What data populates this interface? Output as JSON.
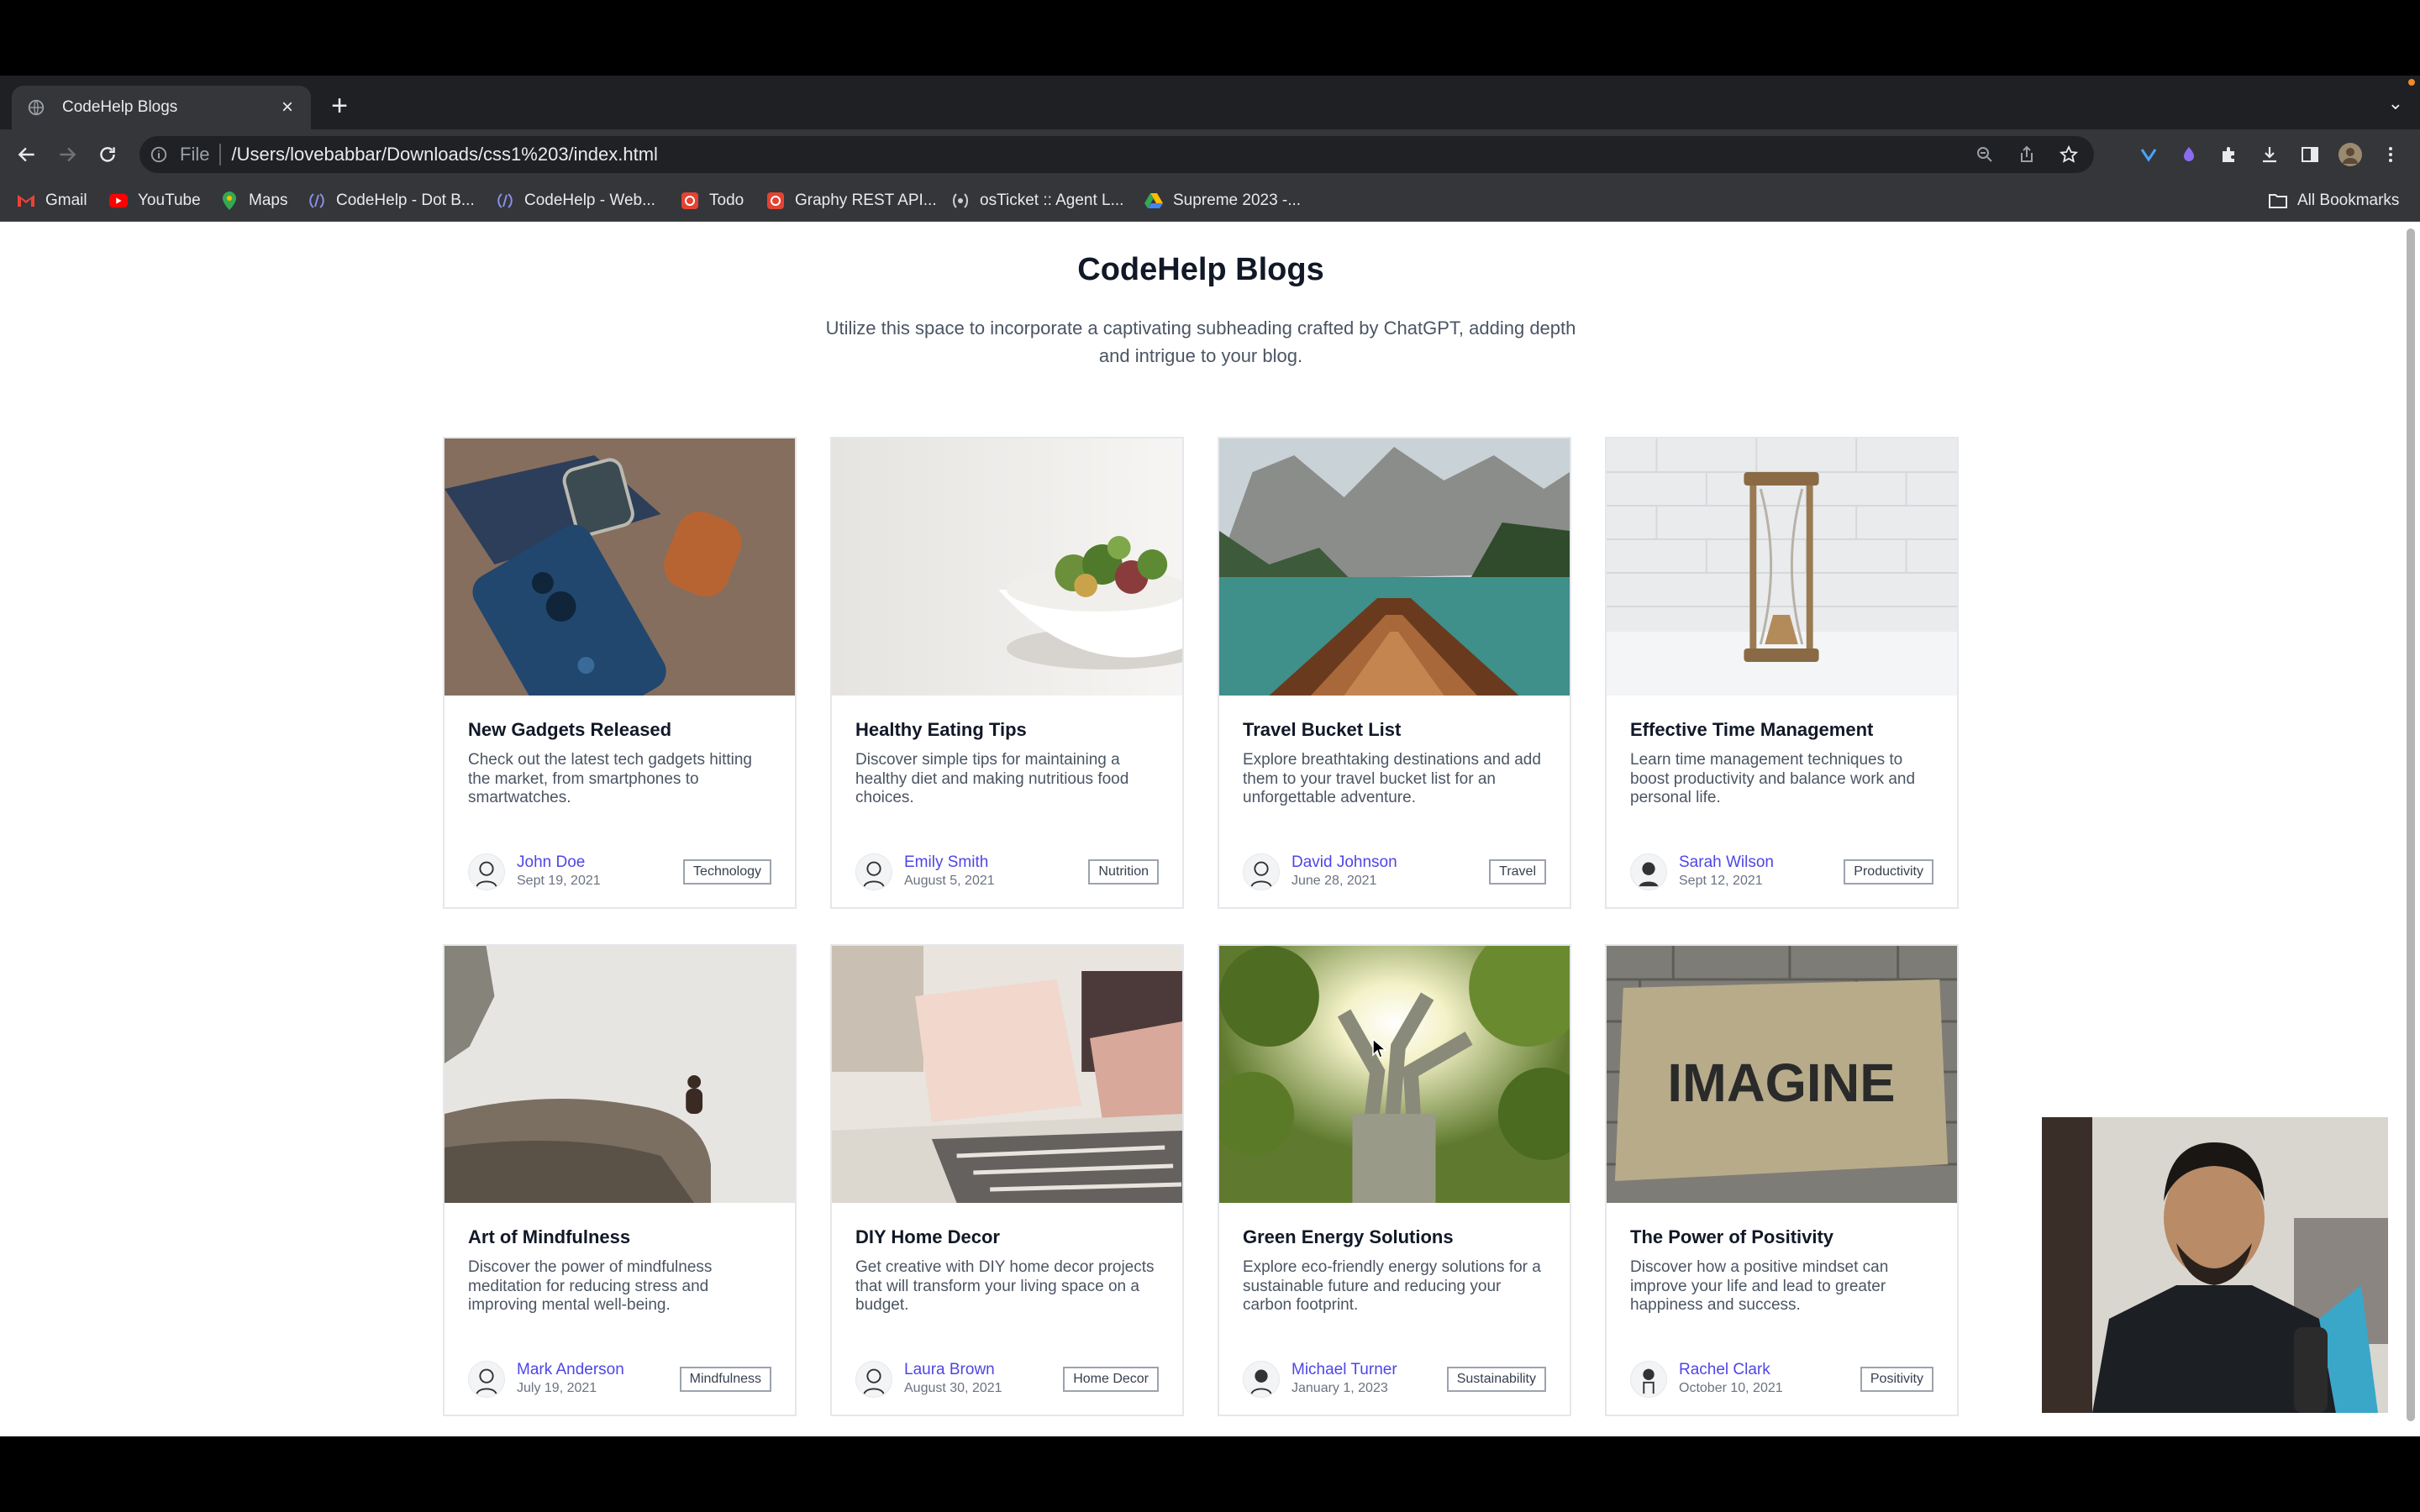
{
  "browser": {
    "tab_title": "CodeHelp Blogs",
    "new_tab_label": "+",
    "scheme_label": "File",
    "url": "/Users/lovebabbar/Downloads/css1%203/index.html"
  },
  "bookmarks": [
    {
      "label": "Gmail",
      "icon": "gmail-icon"
    },
    {
      "label": "YouTube",
      "icon": "youtube-icon"
    },
    {
      "label": "Maps",
      "icon": "maps-icon"
    },
    {
      "label": "CodeHelp - Dot B...",
      "icon": "codehelp-icon"
    },
    {
      "label": "CodeHelp - Web...",
      "icon": "codehelp-icon"
    },
    {
      "label": "Todo",
      "icon": "todo-icon"
    },
    {
      "label": "Graphy REST API...",
      "icon": "graphy-icon"
    },
    {
      "label": "osTicket :: Agent L...",
      "icon": "osticket-icon"
    },
    {
      "label": "Supreme 2023 -...",
      "icon": "drive-icon"
    }
  ],
  "all_bookmarks_label": "All Bookmarks",
  "page": {
    "title": "CodeHelp Blogs",
    "subtitle": "Utilize this space to incorporate a captivating subheading crafted by ChatGPT, adding depth and intrigue to your blog."
  },
  "cards": [
    {
      "title": "New Gadgets Released",
      "description": "Check out the latest tech gadgets hitting the market, from smartphones to smartwatches.",
      "author": "John Doe",
      "date": "Sept 19, 2021",
      "tag": "Technology",
      "image": "gadgets"
    },
    {
      "title": "Healthy Eating Tips",
      "description": "Discover simple tips for maintaining a healthy diet and making nutritious food choices.",
      "author": "Emily Smith",
      "date": "August 5, 2021",
      "tag": "Nutrition",
      "image": "salad"
    },
    {
      "title": "Travel Bucket List",
      "description": "Explore breathtaking destinations and add them to your travel bucket list for an unforgettable adventure.",
      "author": "David Johnson",
      "date": "June 28, 2021",
      "tag": "Travel",
      "image": "lake"
    },
    {
      "title": "Effective Time Management",
      "description": "Learn time management techniques to boost productivity and balance work and personal life.",
      "author": "Sarah Wilson",
      "date": "Sept 12, 2021",
      "tag": "Productivity",
      "image": "hourglass"
    },
    {
      "title": "Art of Mindfulness",
      "description": "Discover the power of mindfulness meditation for reducing stress and improving mental well-being.",
      "author": "Mark Anderson",
      "date": "July 19, 2021",
      "tag": "Mindfulness",
      "image": "cliff"
    },
    {
      "title": "DIY Home Decor",
      "description": "Get creative with DIY home decor projects that will transform your living space on a budget.",
      "author": "Laura Brown",
      "date": "August 30, 2021",
      "tag": "Home Decor",
      "image": "pillows"
    },
    {
      "title": "Green Energy Solutions",
      "description": "Explore eco-friendly energy solutions for a sustainable future and reducing your carbon footprint.",
      "author": "Michael Turner",
      "date": "January 1, 2023",
      "tag": "Sustainability",
      "image": "tree"
    },
    {
      "title": "The Power of Positivity",
      "description": "Discover how a positive mindset can improve your life and lead to greater happiness and success.",
      "author": "Rachel Clark",
      "date": "October 10, 2021",
      "tag": "Positivity",
      "image": "imagine"
    }
  ],
  "image_text": {
    "imagine_sign": "IMAGINE"
  },
  "colors": {
    "author_link": "#4f46e5",
    "browser_chrome": "#35363a",
    "tab_strip": "#1f2023"
  }
}
